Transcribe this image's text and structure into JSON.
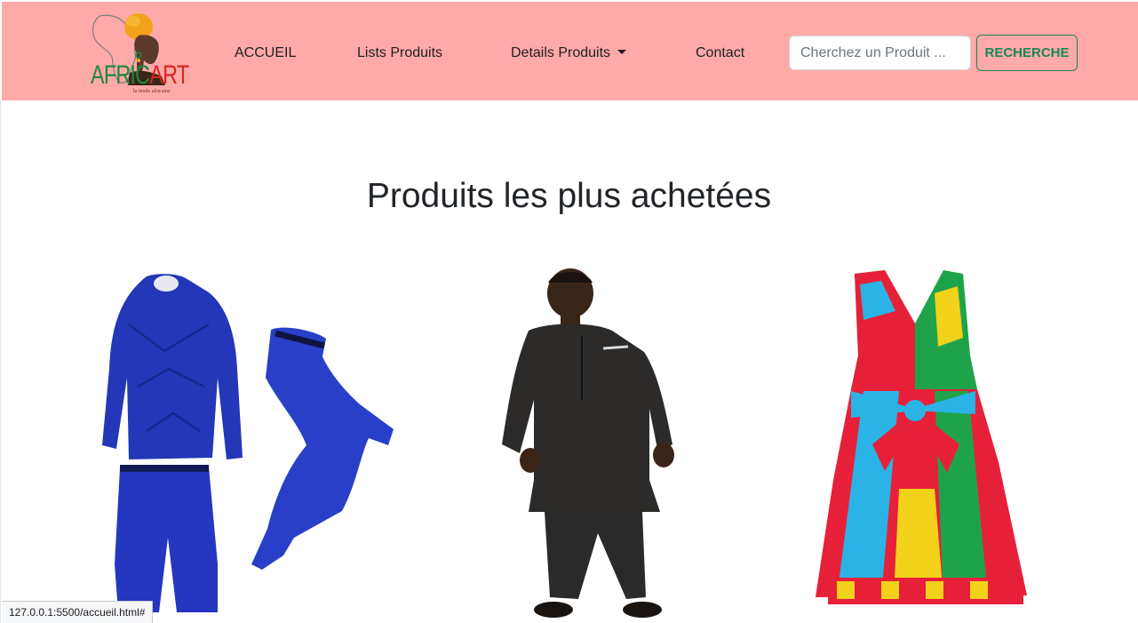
{
  "brand": {
    "name_part1": "AFRIC",
    "name_part2": "ART",
    "tagline": "la mode africaine",
    "colors": {
      "green": "#1c8a3c",
      "red": "#d9261c",
      "turban": "#f4a11d"
    }
  },
  "nav": {
    "background": "#ffaaa9",
    "items": [
      {
        "label": "ACCUEIL"
      },
      {
        "label": "Lists Produits"
      },
      {
        "label": "Details Produits",
        "dropdown": true,
        "icon": "caret-down-icon"
      },
      {
        "label": "Contact"
      }
    ]
  },
  "search": {
    "placeholder": "Cherchez un Produit ...",
    "value": "",
    "button_label": "RECHERCHE",
    "button_color": "#198754"
  },
  "main": {
    "title": "Produits les plus achetées",
    "products": [
      {
        "image": "blue compression sportswear set (long sleeve shirt, shorts, leggings)"
      },
      {
        "image": "man wearing black traditional african boubou suit"
      },
      {
        "image": "multicolor african wax print sleeveless dress with bow"
      }
    ]
  },
  "status_bar": {
    "url": "127.0.0.1:5500/accueil.html#"
  }
}
